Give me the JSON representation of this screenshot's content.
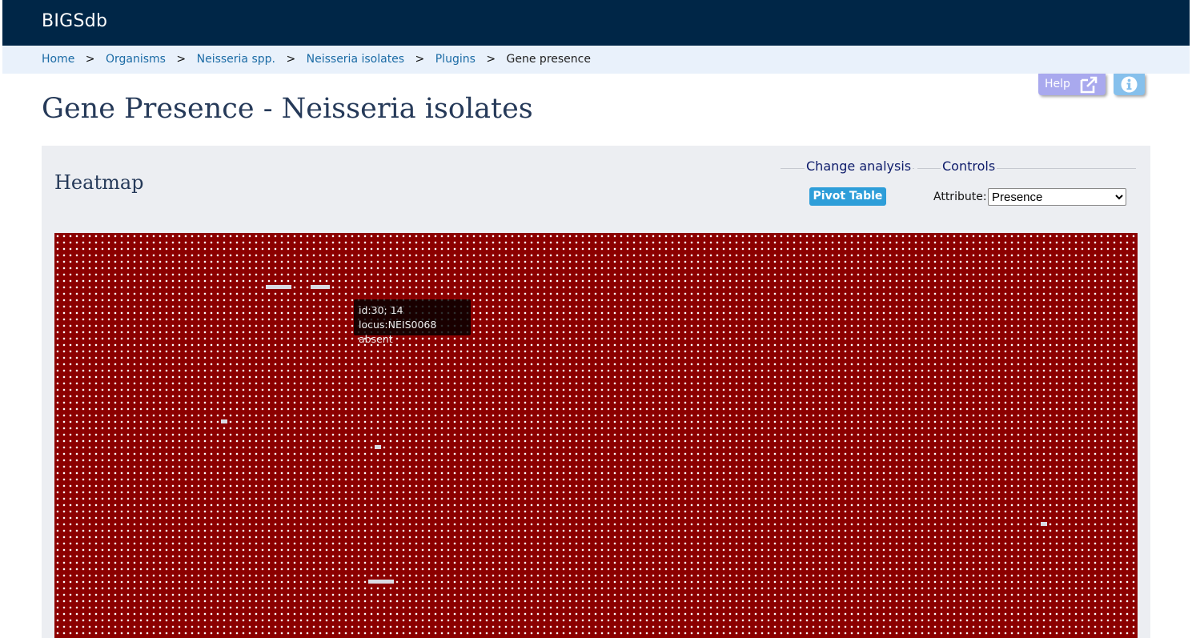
{
  "header": {
    "brand": "BIGSdb"
  },
  "breadcrumbs": {
    "items": [
      "Home",
      "Organisms",
      "Neisseria spp.",
      "Neisseria isolates",
      "Plugins"
    ],
    "separator": ">",
    "current": "Gene presence"
  },
  "toolbar": {
    "help_label": "Help",
    "help_icon": "external-link-icon",
    "info_icon": "info-circle-icon"
  },
  "page": {
    "title": "Gene Presence - Neisseria isolates"
  },
  "panel": {
    "heading": "Heatmap",
    "change_analysis": {
      "legend": "Change analysis",
      "pivot_button": "Pivot Table"
    },
    "controls": {
      "legend": "Controls",
      "attribute_label": "Attribute:",
      "attribute_value": "Presence"
    }
  },
  "heatmap": {
    "present_color": "#8b0000",
    "absent_color": "#ffffff",
    "tooltip": {
      "line1": "id:30; 14",
      "line2": "locus:NEIS0068 absent"
    }
  }
}
